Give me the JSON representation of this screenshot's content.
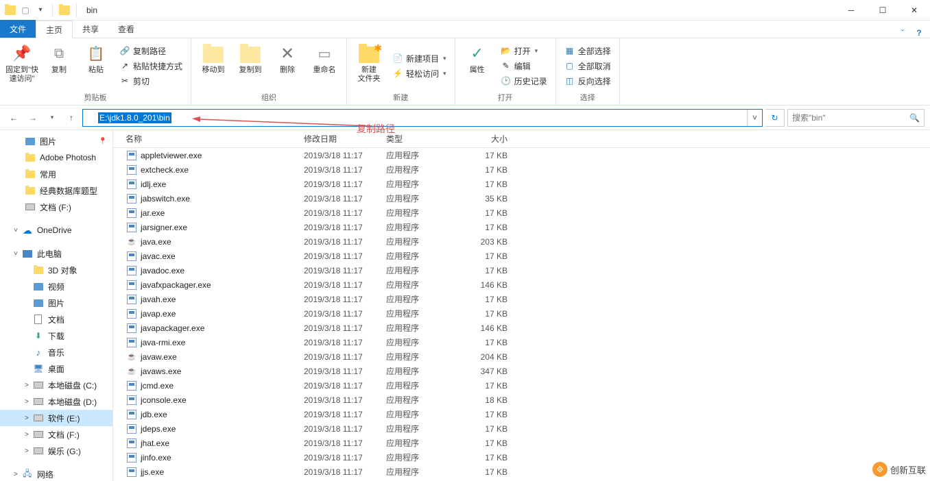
{
  "window": {
    "title": "bin"
  },
  "qat": {
    "dropdown": "▾"
  },
  "tabs": {
    "file": "文件",
    "home": "主页",
    "share": "共享",
    "view": "查看"
  },
  "ribbon": {
    "clipboard": {
      "pin": "固定到\"快\n速访问\"",
      "copy": "复制",
      "paste": "粘贴",
      "copypath": "复制路径",
      "pasteshortcut": "粘贴快捷方式",
      "cut": "剪切",
      "label": "剪贴板"
    },
    "organize": {
      "moveto": "移动到",
      "copyto": "复制到",
      "delete": "删除",
      "rename": "重命名",
      "label": "组织"
    },
    "new": {
      "newfolder": "新建\n文件夹",
      "newitem": "新建项目",
      "easyaccess": "轻松访问",
      "label": "新建"
    },
    "open": {
      "properties": "属性",
      "open": "打开",
      "edit": "编辑",
      "history": "历史记录",
      "label": "打开"
    },
    "select": {
      "selectall": "全部选择",
      "selectnone": "全部取消",
      "invert": "反向选择",
      "label": "选择"
    }
  },
  "nav": {
    "path": "E:\\jdk1.8.0_201\\bin",
    "search_placeholder": "搜索\"bin\""
  },
  "annotation": "复制路径",
  "sidebar": {
    "items": [
      {
        "label": "图片",
        "icon": "pic",
        "pin": true
      },
      {
        "label": "Adobe Photosh",
        "icon": "folder"
      },
      {
        "label": "常用",
        "icon": "folder"
      },
      {
        "label": "经典数据库题型",
        "icon": "folder"
      },
      {
        "label": "文档 (F:)",
        "icon": "drive"
      }
    ],
    "onedrive": "OneDrive",
    "thispc": "此电脑",
    "pcitems": [
      {
        "label": "3D 对象",
        "icon": "folder"
      },
      {
        "label": "视频",
        "icon": "pic"
      },
      {
        "label": "图片",
        "icon": "pic"
      },
      {
        "label": "文档",
        "icon": "doc"
      },
      {
        "label": "下载",
        "icon": "down"
      },
      {
        "label": "音乐",
        "icon": "music"
      },
      {
        "label": "桌面",
        "icon": "desk"
      },
      {
        "label": "本地磁盘 (C:)",
        "icon": "drive"
      },
      {
        "label": "本地磁盘 (D:)",
        "icon": "drive"
      },
      {
        "label": "软件 (E:)",
        "icon": "drive",
        "sel": true
      },
      {
        "label": "文档 (F:)",
        "icon": "drive"
      },
      {
        "label": "娱乐 (G:)",
        "icon": "drive"
      }
    ],
    "network": "网络"
  },
  "columns": {
    "name": "名称",
    "date": "修改日期",
    "type": "类型",
    "size": "大小"
  },
  "files": [
    {
      "name": "appletviewer.exe",
      "date": "2019/3/18 11:17",
      "type": "应用程序",
      "size": "17 KB",
      "icon": "exe"
    },
    {
      "name": "extcheck.exe",
      "date": "2019/3/18 11:17",
      "type": "应用程序",
      "size": "17 KB",
      "icon": "exe"
    },
    {
      "name": "idlj.exe",
      "date": "2019/3/18 11:17",
      "type": "应用程序",
      "size": "17 KB",
      "icon": "exe"
    },
    {
      "name": "jabswitch.exe",
      "date": "2019/3/18 11:17",
      "type": "应用程序",
      "size": "35 KB",
      "icon": "exe"
    },
    {
      "name": "jar.exe",
      "date": "2019/3/18 11:17",
      "type": "应用程序",
      "size": "17 KB",
      "icon": "exe"
    },
    {
      "name": "jarsigner.exe",
      "date": "2019/3/18 11:17",
      "type": "应用程序",
      "size": "17 KB",
      "icon": "exe"
    },
    {
      "name": "java.exe",
      "date": "2019/3/18 11:17",
      "type": "应用程序",
      "size": "203 KB",
      "icon": "java"
    },
    {
      "name": "javac.exe",
      "date": "2019/3/18 11:17",
      "type": "应用程序",
      "size": "17 KB",
      "icon": "exe"
    },
    {
      "name": "javadoc.exe",
      "date": "2019/3/18 11:17",
      "type": "应用程序",
      "size": "17 KB",
      "icon": "exe"
    },
    {
      "name": "javafxpackager.exe",
      "date": "2019/3/18 11:17",
      "type": "应用程序",
      "size": "146 KB",
      "icon": "exe"
    },
    {
      "name": "javah.exe",
      "date": "2019/3/18 11:17",
      "type": "应用程序",
      "size": "17 KB",
      "icon": "exe"
    },
    {
      "name": "javap.exe",
      "date": "2019/3/18 11:17",
      "type": "应用程序",
      "size": "17 KB",
      "icon": "exe"
    },
    {
      "name": "javapackager.exe",
      "date": "2019/3/18 11:17",
      "type": "应用程序",
      "size": "146 KB",
      "icon": "exe"
    },
    {
      "name": "java-rmi.exe",
      "date": "2019/3/18 11:17",
      "type": "应用程序",
      "size": "17 KB",
      "icon": "exe"
    },
    {
      "name": "javaw.exe",
      "date": "2019/3/18 11:17",
      "type": "应用程序",
      "size": "204 KB",
      "icon": "java"
    },
    {
      "name": "javaws.exe",
      "date": "2019/3/18 11:17",
      "type": "应用程序",
      "size": "347 KB",
      "icon": "java"
    },
    {
      "name": "jcmd.exe",
      "date": "2019/3/18 11:17",
      "type": "应用程序",
      "size": "17 KB",
      "icon": "exe"
    },
    {
      "name": "jconsole.exe",
      "date": "2019/3/18 11:17",
      "type": "应用程序",
      "size": "18 KB",
      "icon": "exe"
    },
    {
      "name": "jdb.exe",
      "date": "2019/3/18 11:17",
      "type": "应用程序",
      "size": "17 KB",
      "icon": "exe"
    },
    {
      "name": "jdeps.exe",
      "date": "2019/3/18 11:17",
      "type": "应用程序",
      "size": "17 KB",
      "icon": "exe"
    },
    {
      "name": "jhat.exe",
      "date": "2019/3/18 11:17",
      "type": "应用程序",
      "size": "17 KB",
      "icon": "exe"
    },
    {
      "name": "jinfo.exe",
      "date": "2019/3/18 11:17",
      "type": "应用程序",
      "size": "17 KB",
      "icon": "exe"
    },
    {
      "name": "jjs.exe",
      "date": "2019/3/18 11:17",
      "type": "应用程序",
      "size": "17 KB",
      "icon": "exe"
    }
  ],
  "watermark": "创新互联"
}
